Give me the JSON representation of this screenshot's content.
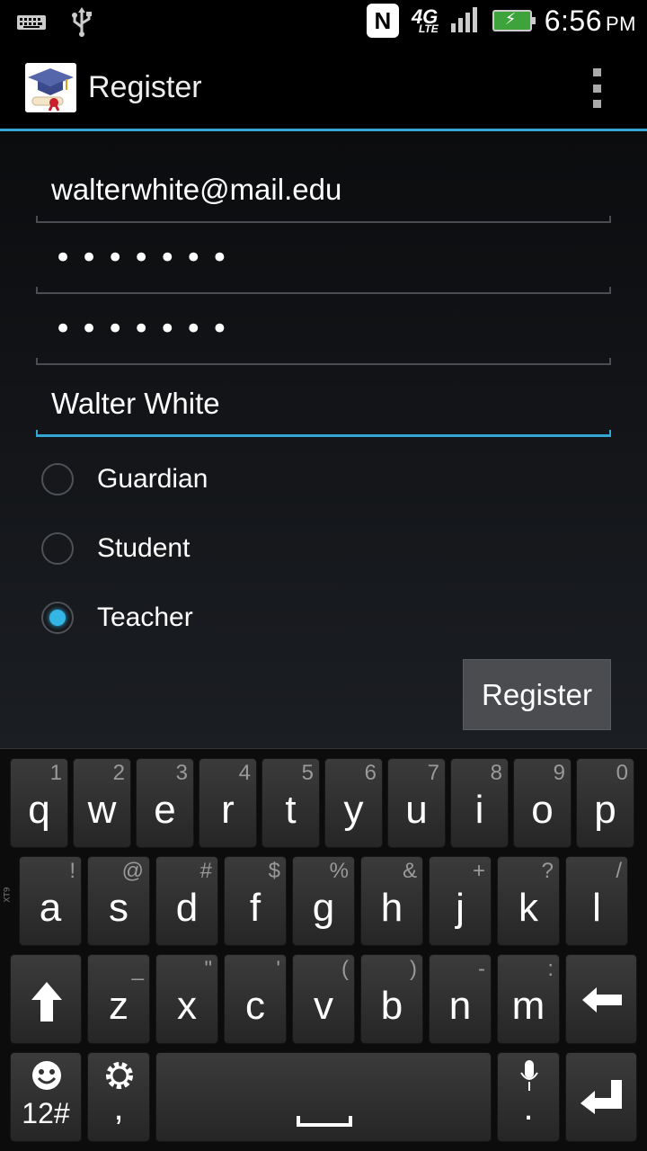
{
  "status_bar": {
    "time": "6:56",
    "ampm": "PM",
    "network": "4G",
    "network_sub": "LTE",
    "nfc": "N",
    "icons": [
      "keyboard-icon",
      "usb-icon",
      "nfc-icon",
      "lte-icon",
      "signal-icon",
      "battery-charging-icon"
    ]
  },
  "action_bar": {
    "title": "Register",
    "app_icon": "graduation-cap-icon",
    "overflow_icon": "overflow-menu-icon"
  },
  "form": {
    "email_value": "walterwhite@mail.edu",
    "password_value": "•••••••",
    "confirm_password_value": "•••••••",
    "name_value": "Walter White",
    "roles": [
      {
        "label": "Guardian",
        "checked": false
      },
      {
        "label": "Student",
        "checked": false
      },
      {
        "label": "Teacher",
        "checked": true
      }
    ],
    "submit_label": "Register"
  },
  "keyboard": {
    "side_label": "XT9",
    "row1": [
      {
        "main": "q",
        "alt": "1"
      },
      {
        "main": "w",
        "alt": "2"
      },
      {
        "main": "e",
        "alt": "3"
      },
      {
        "main": "r",
        "alt": "4"
      },
      {
        "main": "t",
        "alt": "5"
      },
      {
        "main": "y",
        "alt": "6"
      },
      {
        "main": "u",
        "alt": "7"
      },
      {
        "main": "i",
        "alt": "8"
      },
      {
        "main": "o",
        "alt": "9"
      },
      {
        "main": "p",
        "alt": "0"
      }
    ],
    "row2": [
      {
        "main": "a",
        "alt": "!"
      },
      {
        "main": "s",
        "alt": "@"
      },
      {
        "main": "d",
        "alt": "#"
      },
      {
        "main": "f",
        "alt": "$"
      },
      {
        "main": "g",
        "alt": "%"
      },
      {
        "main": "h",
        "alt": "&"
      },
      {
        "main": "j",
        "alt": "+"
      },
      {
        "main": "k",
        "alt": "?"
      },
      {
        "main": "l",
        "alt": "/"
      }
    ],
    "row3": [
      {
        "main": "z",
        "alt": "_"
      },
      {
        "main": "x",
        "alt": "\""
      },
      {
        "main": "c",
        "alt": "'"
      },
      {
        "main": "v",
        "alt": "("
      },
      {
        "main": "b",
        "alt": ")"
      },
      {
        "main": "n",
        "alt": "-"
      },
      {
        "main": "m",
        "alt": ":"
      }
    ],
    "symbols_label": "12#",
    "comma_label": ",",
    "period_label": "."
  }
}
